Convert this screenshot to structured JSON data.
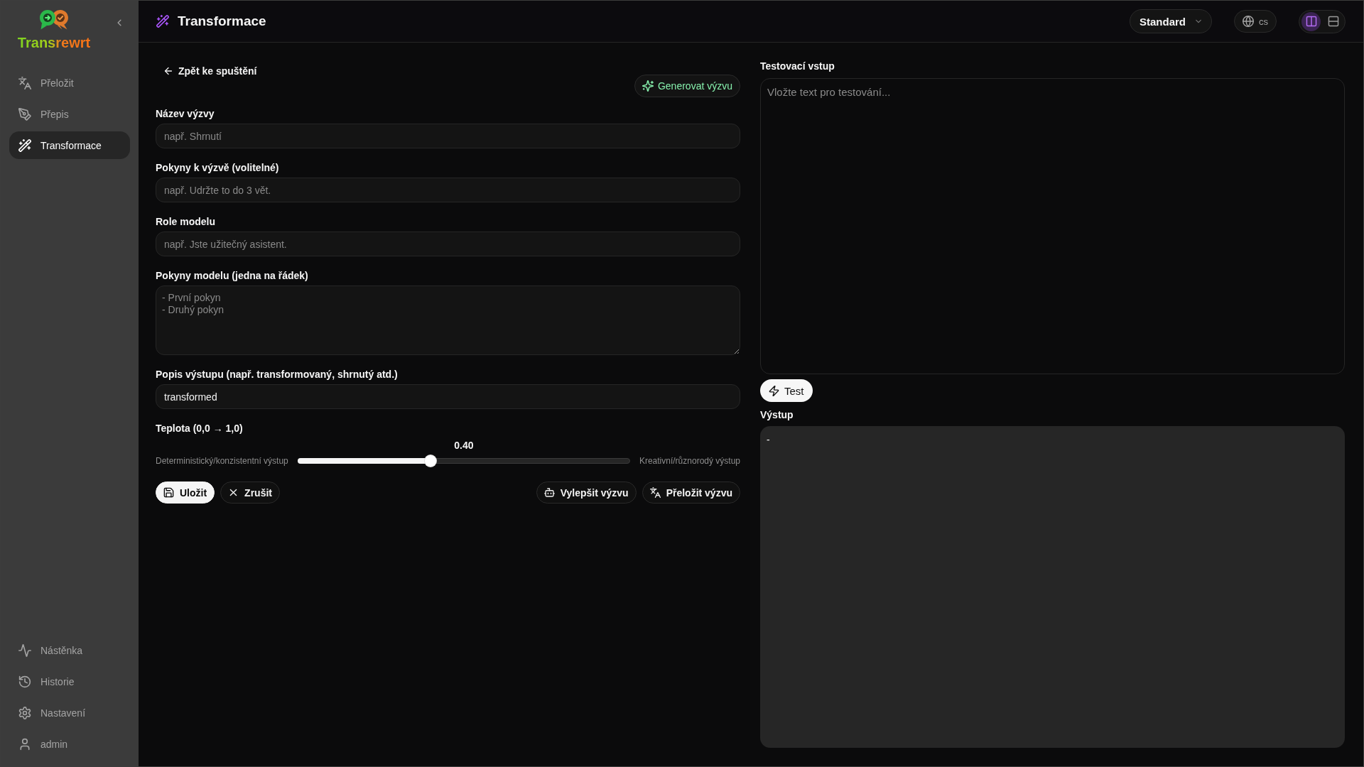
{
  "sidebar": {
    "logo_text": "Transrewrt",
    "nav_items": [
      {
        "label": "Přeložit",
        "selected": false
      },
      {
        "label": "Přepis",
        "selected": false
      },
      {
        "label": "Transformace",
        "selected": true
      }
    ],
    "bottom_items": [
      {
        "label": "Nástěnka",
        "selected": false
      },
      {
        "label": "Historie",
        "selected": false
      },
      {
        "label": "Nastavení",
        "selected": false
      },
      {
        "label": "admin",
        "selected": false
      }
    ]
  },
  "header": {
    "title": "Transformace",
    "mode": "Standard",
    "language": "cs",
    "layout_options": [
      {
        "kind": "columns",
        "selected": true
      },
      {
        "kind": "rows",
        "selected": false
      }
    ]
  },
  "editor": {
    "back_link": "Zpět ke spuštění",
    "generate_button": "Generovat výzvu",
    "fields": [
      {
        "kind": "input",
        "label": "Název výzvy",
        "placeholder": "např. Shrnutí"
      },
      {
        "kind": "input",
        "label": "Pokyny k výzvě (volitelné)",
        "placeholder": "např. Udržte to do 3 vět."
      },
      {
        "kind": "input",
        "label": "Role modelu",
        "placeholder": "např. Jste užitečný asistent."
      },
      {
        "kind": "textarea",
        "label": "Pokyny modelu (jedna na řádek)",
        "placeholder": "- První pokyn\n- Druhý pokyn"
      },
      {
        "kind": "input",
        "label": "Popis výstupu (např. transformovaný, shrnutý atd.)",
        "value": "transformed"
      }
    ],
    "temperature": {
      "label": "Teplota (0,0 → 1,0)",
      "reading": "0.40",
      "min_label": "Deterministický/konzistentní výstup",
      "max_label": "Kreativní/různorodý výstup",
      "level": 0.4
    },
    "left_actions": [
      {
        "label": "Uložit",
        "kind": "primary"
      },
      {
        "label": "Zrušit",
        "kind": "secondary"
      }
    ],
    "right_actions": [
      {
        "label": "Vylepšit výzvu",
        "kind": "secondary"
      },
      {
        "label": "Přeložit výzvu",
        "kind": "secondary"
      }
    ]
  },
  "test_panel": {
    "input": {
      "label": "Testovací vstup",
      "placeholder": "Vložte text pro testování..."
    },
    "test_button": "Test",
    "output": {
      "label": "Výstup",
      "text": "-"
    }
  }
}
